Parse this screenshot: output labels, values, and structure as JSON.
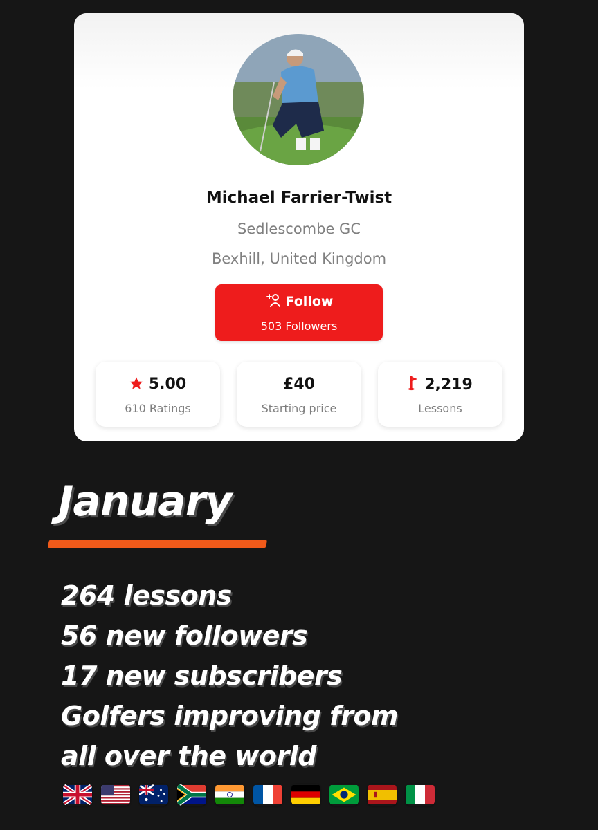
{
  "profile": {
    "name": "Michael Farrier-Twist",
    "club": "Sedlescombe GC",
    "location": "Bexhill, United Kingdom",
    "follow_label": "Follow",
    "followers_text": "503 Followers"
  },
  "stats": [
    {
      "icon": "star-icon",
      "value": "5.00",
      "label": "610 Ratings"
    },
    {
      "icon": "",
      "value": "£40",
      "label": "Starting price"
    },
    {
      "icon": "golf-flag-icon",
      "value": "2,219",
      "label": "Lessons"
    }
  ],
  "summary": {
    "month": "January",
    "lines": [
      "264 lessons",
      "56 new followers",
      "17 new subscribers",
      "Golfers improving from",
      "all over the world"
    ]
  },
  "flags": [
    "uk-flag",
    "usa-flag",
    "australia-flag",
    "south-africa-flag",
    "india-flag",
    "france-flag",
    "germany-flag",
    "brazil-flag",
    "spain-flag",
    "italy-flag"
  ],
  "colors": {
    "accent": "#ee1c1c",
    "underline": "#f05a1a",
    "background": "#161616"
  }
}
